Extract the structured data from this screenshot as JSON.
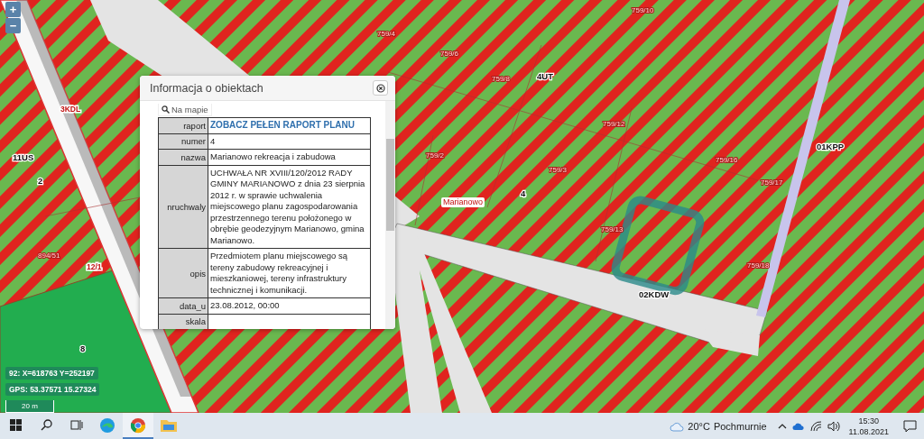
{
  "map": {
    "zoom_controls": [
      "+",
      "−"
    ],
    "zone_labels": [
      "11US",
      "2",
      "4UT",
      "4",
      "01KPP",
      "02KDW",
      "8"
    ],
    "parcel_labels": [
      "759/10",
      "759/8",
      "759/4",
      "759/6",
      "759/12",
      "759/16",
      "759/2",
      "759/17",
      "759/13",
      "759/18",
      "759/3",
      "894/51"
    ],
    "road_labels": [
      "3KDL",
      "12/1"
    ],
    "place_label": "Marianowo",
    "coordinates": [
      "92: X=618763 Y=252197",
      "GPS: 53.37571 15.27324"
    ],
    "scale": "20 m"
  },
  "info_panel": {
    "title": "Informacja o obiektach",
    "locate_link": "Na mapie",
    "rows": [
      {
        "key": "raport",
        "value": "ZOBACZ PEŁEN RAPORT PLANU",
        "kind": "link"
      },
      {
        "key": "numer",
        "value": "4",
        "kind": "text"
      },
      {
        "key": "nazwa",
        "value": "Marianowo rekreacja i zabudowa",
        "kind": "text"
      },
      {
        "key": "nruchwaly",
        "value": "UCHWAŁA NR XVIII/120/2012 RADY GMINY MARIANOWO z dnia 23 sierpnia 2012 r. w sprawie uchwalenia miejscowego planu zagospodarowania przestrzennego terenu położonego w obrębie geodezyjnym Marianowo, gmina Marianowo.",
        "kind": "text"
      },
      {
        "key": "opis",
        "value": "Przedmiotem planu miejscowego są tereny zabudowy rekreacyjnej i mieszkaniowej, tereny infrastruktury technicznej i komunikacji.",
        "kind": "text"
      },
      {
        "key": "data_u",
        "value": "23.08.2012, 00:00",
        "kind": "text"
      },
      {
        "key": "skala",
        "value": "",
        "kind": "text"
      }
    ]
  },
  "taskbar": {
    "apps": [
      {
        "kind": "start",
        "selected": false
      },
      {
        "kind": "search",
        "selected": false
      },
      {
        "kind": "taskview",
        "selected": false
      },
      {
        "kind": "edge",
        "selected": false
      },
      {
        "kind": "chrome",
        "selected": true
      },
      {
        "kind": "explorer",
        "selected": false
      }
    ],
    "weather": {
      "temperature": "20°C",
      "condition": "Pochmurnie"
    },
    "time": "15:30",
    "date": "11.08.2021"
  }
}
